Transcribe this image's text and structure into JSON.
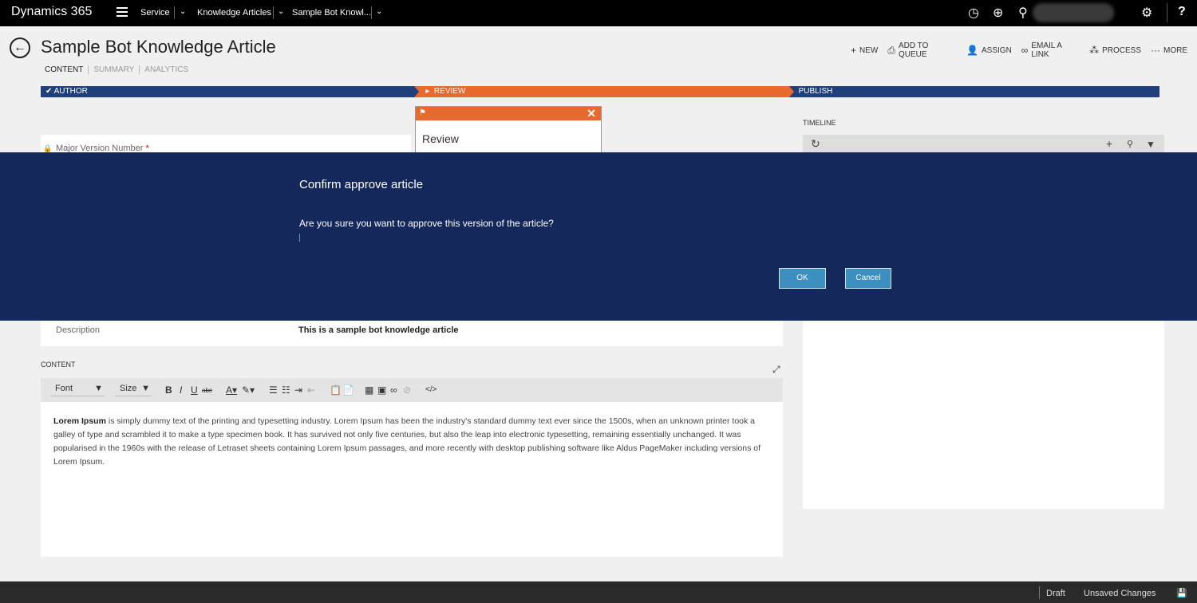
{
  "topbar": {
    "brand": "Dynamics 365",
    "crumbs": [
      "Service",
      "Knowledge Articles",
      "Sample Bot Knowl..."
    ]
  },
  "header": {
    "title": "Sample Bot Knowledge Article",
    "tabs": [
      "CONTENT",
      "SUMMARY",
      "ANALYTICS"
    ],
    "commands": [
      {
        "icon": "plus-icon",
        "label": "NEW"
      },
      {
        "icon": "queue-icon",
        "label": "ADD TO QUEUE"
      },
      {
        "icon": "assign-icon",
        "label": "ASSIGN"
      },
      {
        "icon": "link-icon",
        "label": "EMAIL A LINK"
      },
      {
        "icon": "process-icon",
        "label": "PROCESS"
      },
      {
        "icon": "more-icon",
        "label": "MORE"
      }
    ]
  },
  "process": {
    "stages": [
      "AUTHOR",
      "REVIEW",
      "PUBLISH"
    ],
    "flyout_title": "Review",
    "active_color": "#e8692e",
    "stage_color": "#1f3f7a"
  },
  "form": {
    "field_label": "Major Version Number",
    "required_mark": "*",
    "description_label": "Description",
    "description_value": "This is a sample bot knowledge article",
    "content_label": "CONTENT",
    "font_select": "Font",
    "size_select": "Size",
    "content_bold": "Lorem Ipsum",
    "content_text": " is simply dummy text of the printing and typesetting industry. Lorem Ipsum has been the industry's standard dummy text ever since the 1500s, when an unknown printer took a galley of type and scrambled it to make a type specimen book. It has survived not only five centuries, but also the leap into electronic typesetting, remaining essentially unchanged. It was popularised in the 1960s with the release of Letraset sheets containing Lorem Ipsum passages, and more recently with desktop publishing software like Aldus PageMaker including versions of Lorem Ipsum."
  },
  "timeline": {
    "label": "TIMELINE"
  },
  "modal": {
    "title": "Confirm approve article",
    "message": "Are you sure you want to approve this version of the article?",
    "ok_label": "OK",
    "cancel_label": "Cancel",
    "bg_color": "#14285c"
  },
  "footer": {
    "status": "Draft",
    "unsaved": "Unsaved Changes"
  }
}
